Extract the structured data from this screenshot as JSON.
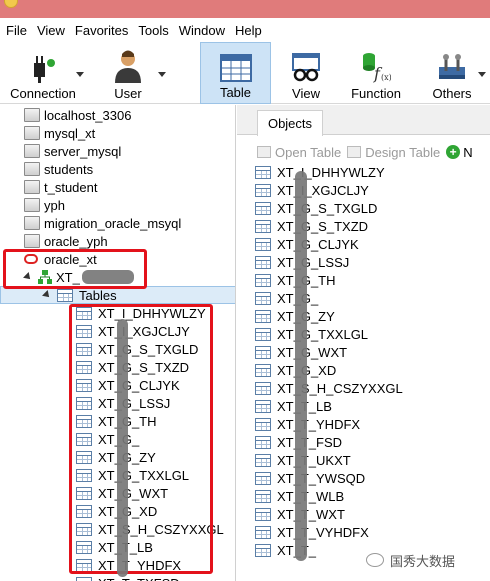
{
  "menu": [
    "File",
    "View",
    "Favorites",
    "Tools",
    "Window",
    "Help"
  ],
  "toolbar": {
    "connection": "Connection",
    "user": "User",
    "table": "Table",
    "view": "View",
    "function": "Function",
    "others": "Others"
  },
  "connections": [
    "localhost_3306",
    "mysql_xt",
    "server_mysql",
    "students",
    "t_student",
    "yph",
    "migration_oracle_msyql",
    "oracle_yph"
  ],
  "oracle": {
    "name": "oracle_xt",
    "schema": "XT_",
    "tables_label": "Tables"
  },
  "tree_tables": [
    "XT_I_DHHYWLZY",
    "XT_I_XGJCLJY",
    "XT_G_S_TXGLD",
    "XT_G_S_TXZD",
    "XT_G_CLJYK",
    "XT_G_LSSJ",
    "XT_G_TH",
    "XT_G_",
    "XT_G_ZY",
    "XT_G_TXXLGL",
    "XT_G_WXT",
    "XT_G_XD",
    "XT_S_H_CSZYXXGL",
    "XT_T_LB",
    "XT_T_YHDFX",
    "XT_T_TXFSD"
  ],
  "objects_tab": "Objects",
  "objects_toolbar": {
    "open": "Open Table",
    "design": "Design Table",
    "new": "N"
  },
  "object_tables": [
    "XT_I_DHHYWLZY",
    "XT_I_XGJCLJY",
    "XT_G_S_TXGLD",
    "XT_G_S_TXZD",
    "XT_G_CLJYK",
    "XT_G_LSSJ",
    "XT_G_TH",
    "XT_G_",
    "XT_G_ZY",
    "XT_G_TXXLGL",
    "XT_G_WXT",
    "XT_G_XD",
    "XT_S_H_CSZYXXGL",
    "XT_T_LB",
    "XT_T_YHDFX",
    "XT_T_FSD",
    "XT_T_UKXT",
    "XT_T_YWSQD",
    "XT_T_WLB",
    "XT_T_WXT",
    "XT_T_VYHDFX",
    "XT_T_"
  ],
  "watermark": "国秀大数据",
  "colors": {
    "titlebar": "#e07b7b",
    "highlight": "#e3121b",
    "selected": "#cde3f6"
  }
}
